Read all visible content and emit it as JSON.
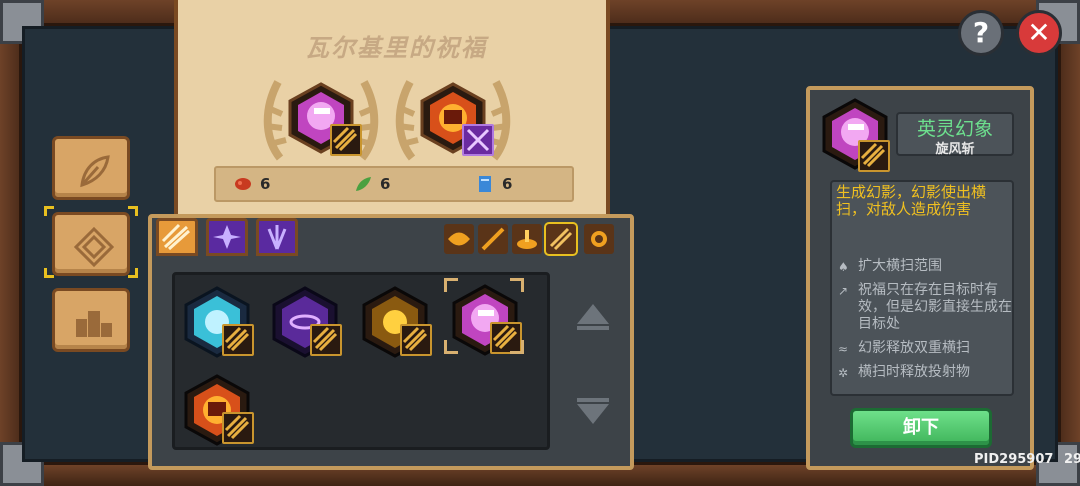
{
  "scroll": {
    "title": "瓦尔基里的祝福",
    "costs": [
      {
        "icon": "meat-icon",
        "value": "6"
      },
      {
        "icon": "leaf-icon",
        "value": "6"
      },
      {
        "icon": "book-icon",
        "value": "6"
      }
    ]
  },
  "detail": {
    "skill_name": "英灵幻象",
    "skill_subname": "旋风斩",
    "description": "生成幻影，幻影使出横扫，对敌人造成伤害",
    "perks": [
      {
        "icon": "tree-icon",
        "text": "扩大横扫范围"
      },
      {
        "icon": "arrow-icon",
        "text": "祝福只在存在目标时有效，但是幻影直接生成在目标处"
      },
      {
        "icon": "wave-icon",
        "text": "幻影释放双重横扫"
      },
      {
        "icon": "gear-icon",
        "text": "横扫时释放投射物"
      }
    ],
    "unequip_label": "卸下"
  },
  "footer": {
    "pid": "PID295907",
    "number": "29"
  },
  "colors": {
    "accent_green": "#6de08e",
    "desc_yellow": "#f0c020",
    "parchment": "#e9d1a6"
  }
}
